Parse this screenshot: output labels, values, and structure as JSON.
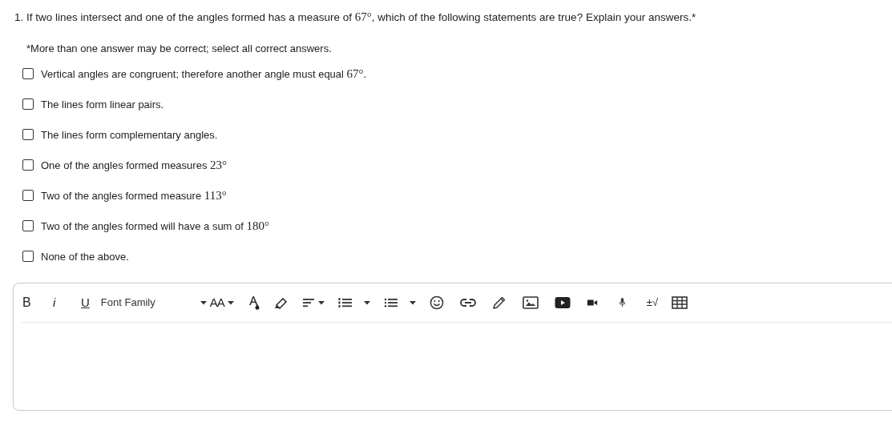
{
  "question": {
    "parts": [
      {
        "kind": "text",
        "text": "1. If two lines intersect and one of the angles formed has a measure of "
      },
      {
        "kind": "math",
        "text": "67°"
      },
      {
        "kind": "text",
        "text": ", which of the following statements are true? Explain your answers.*"
      }
    ]
  },
  "note": "*More than one answer may be correct; select all correct answers.",
  "options": [
    {
      "checked": false,
      "parts": [
        {
          "kind": "text",
          "text": "Vertical angles are congruent; therefore another angle must equal "
        },
        {
          "kind": "math",
          "text": "67°"
        },
        {
          "kind": "text",
          "text": "."
        }
      ]
    },
    {
      "checked": false,
      "parts": [
        {
          "kind": "text",
          "text": "The lines form linear pairs."
        }
      ]
    },
    {
      "checked": false,
      "parts": [
        {
          "kind": "text",
          "text": "The lines form complementary angles."
        }
      ]
    },
    {
      "checked": false,
      "parts": [
        {
          "kind": "text",
          "text": "One of the angles formed measures "
        },
        {
          "kind": "math",
          "text": "23°"
        }
      ]
    },
    {
      "checked": false,
      "parts": [
        {
          "kind": "text",
          "text": "Two of the angles formed measure "
        },
        {
          "kind": "math",
          "text": "113°"
        }
      ]
    },
    {
      "checked": false,
      "parts": [
        {
          "kind": "text",
          "text": "Two of the angles formed will have a sum of "
        },
        {
          "kind": "math",
          "text": "180°"
        }
      ]
    },
    {
      "checked": false,
      "parts": [
        {
          "kind": "text",
          "text": "None of the above."
        }
      ]
    }
  ],
  "toolbar": [
    {
      "kind": "bold",
      "label": "B"
    },
    {
      "kind": "italic",
      "label": "i"
    },
    {
      "kind": "underline",
      "label": "U"
    },
    {
      "kind": "font",
      "label": "Font Family",
      "caret": true
    },
    {
      "kind": "size",
      "label": "AA",
      "caret": true
    },
    {
      "kind": "textcolor"
    },
    {
      "kind": "highlight"
    },
    {
      "kind": "align",
      "caret": true
    },
    {
      "kind": "numbered",
      "caret": true
    },
    {
      "kind": "bullets",
      "caret": true
    },
    {
      "kind": "emoji"
    },
    {
      "kind": "link"
    },
    {
      "kind": "pencil"
    },
    {
      "kind": "image"
    },
    {
      "kind": "video"
    },
    {
      "kind": "camera"
    },
    {
      "kind": "mic"
    },
    {
      "kind": "equation",
      "label": "±√"
    },
    {
      "kind": "table"
    }
  ]
}
